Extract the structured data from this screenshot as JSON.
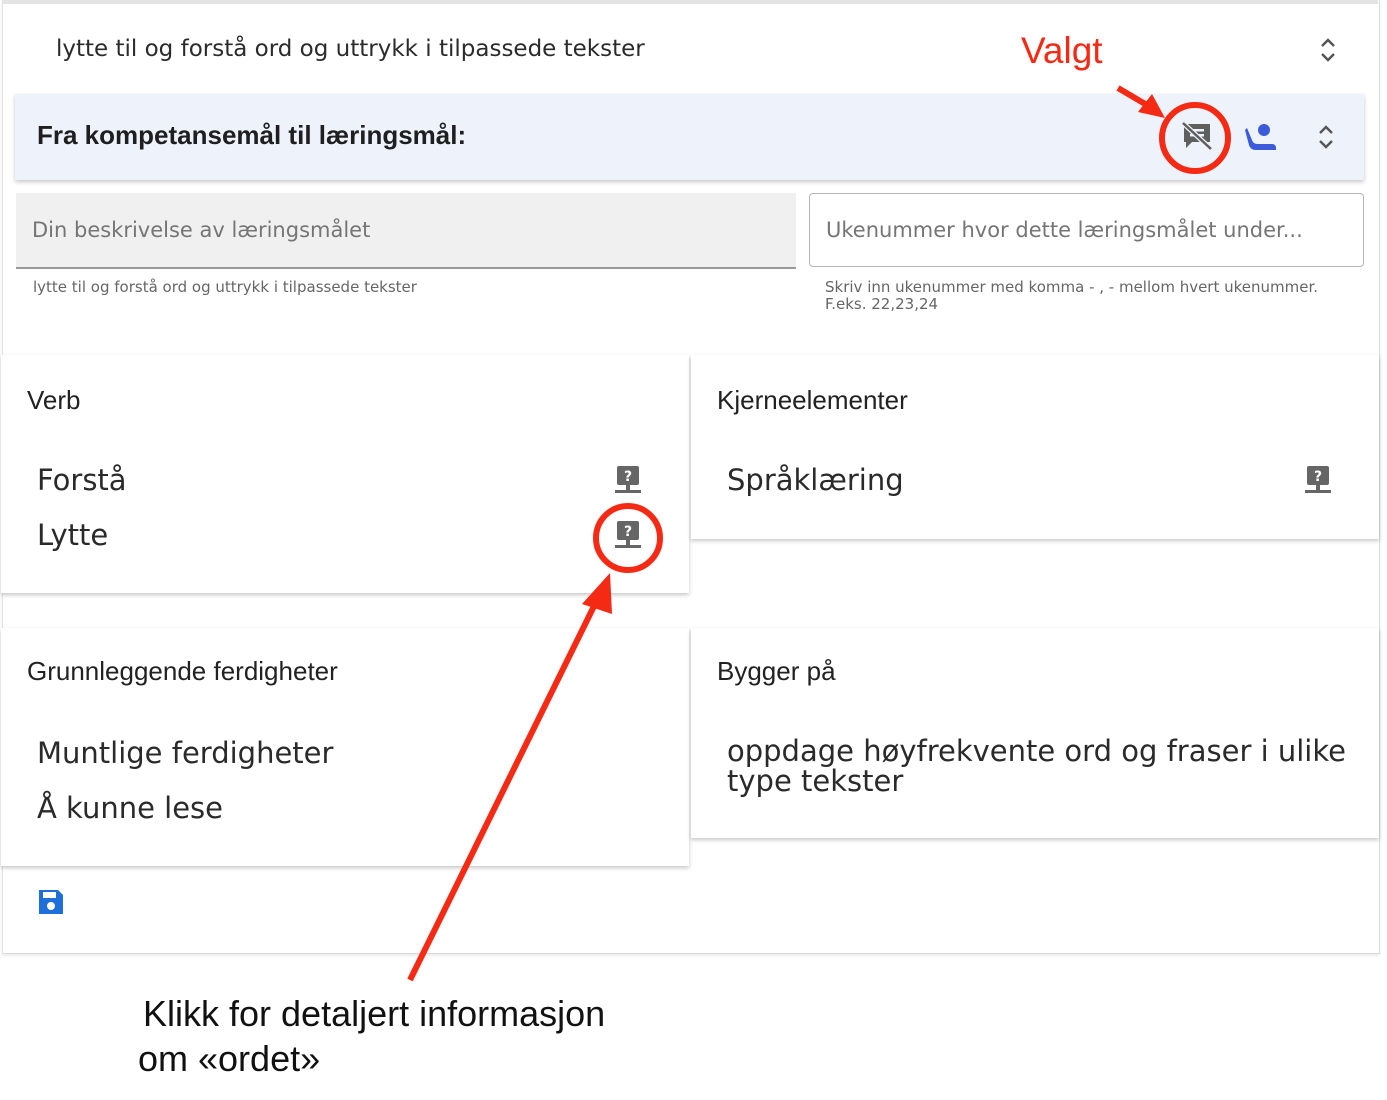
{
  "top_row": {
    "text": "lytte til og forstå ord og uttrykk i tilpassede tekster"
  },
  "header": {
    "title": "Fra kompetansemål til læringsmål:"
  },
  "fields": {
    "description": {
      "placeholder": "Din beskrivelse av læringsmålet",
      "hint": "lytte til og forstå ord og uttrykk i tilpassede tekster"
    },
    "week": {
      "placeholder": "Ukenummer hvor dette læringsmålet under...",
      "hint": "Skriv inn ukenummer med komma - , - mellom hvert ukenummer. F.eks. 22,23,24"
    }
  },
  "cards": {
    "verb": {
      "title": "Verb",
      "items": [
        "Forstå",
        "Lytte"
      ]
    },
    "kjerne": {
      "title": "Kjerneelementer",
      "items": [
        "Språklæring"
      ]
    },
    "grunn": {
      "title": "Grunnleggende ferdigheter",
      "items": [
        "Muntlige ferdigheter",
        "Å kunne lese"
      ]
    },
    "bygger": {
      "title": "Bygger på",
      "items": [
        "oppdage høyfrekvente ord og fraser i ulike type tekster"
      ]
    }
  },
  "annotations": {
    "valgt": "Valgt",
    "klikk_line1": "Klikk for detaljert informasjon",
    "klikk_line2": "om «ordet»"
  },
  "colors": {
    "annotation_red": "#f52a14",
    "accent_blue": "#3b5bdb",
    "save_blue": "#1e6fd9",
    "header_bg": "#eef2fb"
  },
  "icons": [
    "chevron-updown-icon",
    "comments-disabled-icon",
    "person-raised-hand-icon",
    "help-desktop-icon",
    "save-icon"
  ]
}
